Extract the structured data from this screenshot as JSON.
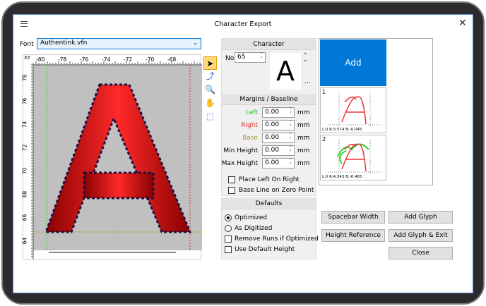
{
  "window": {
    "title": "Character Export",
    "menu_icon": "hamburger-icon",
    "close_icon": "close-icon"
  },
  "font": {
    "label": "Font",
    "value": "Authentink.vfn"
  },
  "ruler": {
    "corner": "XY",
    "x_ticks": [
      "-80",
      "-78",
      "-76",
      "-74",
      "-72",
      "-70",
      "-68"
    ],
    "y_ticks": [
      "78",
      "76",
      "74",
      "72",
      "70",
      "68",
      "66",
      "64"
    ]
  },
  "tools": [
    "pointer-icon",
    "node-edit-icon",
    "zoom-icon",
    "pan-hand-icon",
    "select-region-icon"
  ],
  "character": {
    "header": "Character",
    "no_label": "No",
    "no_value": "65",
    "preview": "A",
    "more": "..."
  },
  "margins": {
    "header": "Margins / Baseline",
    "unit": "mm",
    "fields": [
      {
        "label": "Left",
        "value": "0.00",
        "color": "#22bb22"
      },
      {
        "label": "Right",
        "value": "0.00",
        "color": "#e03030"
      },
      {
        "label": "Base",
        "value": "0.00",
        "color": "#a09a20"
      },
      {
        "label": "Min Height",
        "value": "0.00",
        "color": "#000000"
      },
      {
        "label": "Max Height",
        "value": "0.00",
        "color": "#000000"
      }
    ],
    "checkboxes": [
      {
        "label": "Place Left On Right",
        "checked": false
      },
      {
        "label": "Base Line on Zero Point",
        "checked": false
      }
    ]
  },
  "defaults": {
    "header": "Defaults",
    "radios": [
      {
        "label": "Optimized",
        "checked": true
      },
      {
        "label": "As Digitized",
        "checked": false
      }
    ],
    "checkboxes": [
      {
        "label": "Remove Runs if Optimized",
        "checked": false
      },
      {
        "label": "Use Default Height",
        "checked": false
      }
    ]
  },
  "glyphs": {
    "add_label": "Add",
    "accent": "#0078d7",
    "items": [
      {
        "index": "1",
        "metrics": "L:0 R:3.574 B:-0.045"
      },
      {
        "index": "2",
        "metrics": "L:0 R:4.343 B:-6.465"
      }
    ]
  },
  "buttons": {
    "spacebar": "Spacebar Width",
    "add_glyph": "Add Glyph",
    "height_ref": "Height Reference",
    "add_exit": "Add Glyph & Exit",
    "close": "Close"
  }
}
